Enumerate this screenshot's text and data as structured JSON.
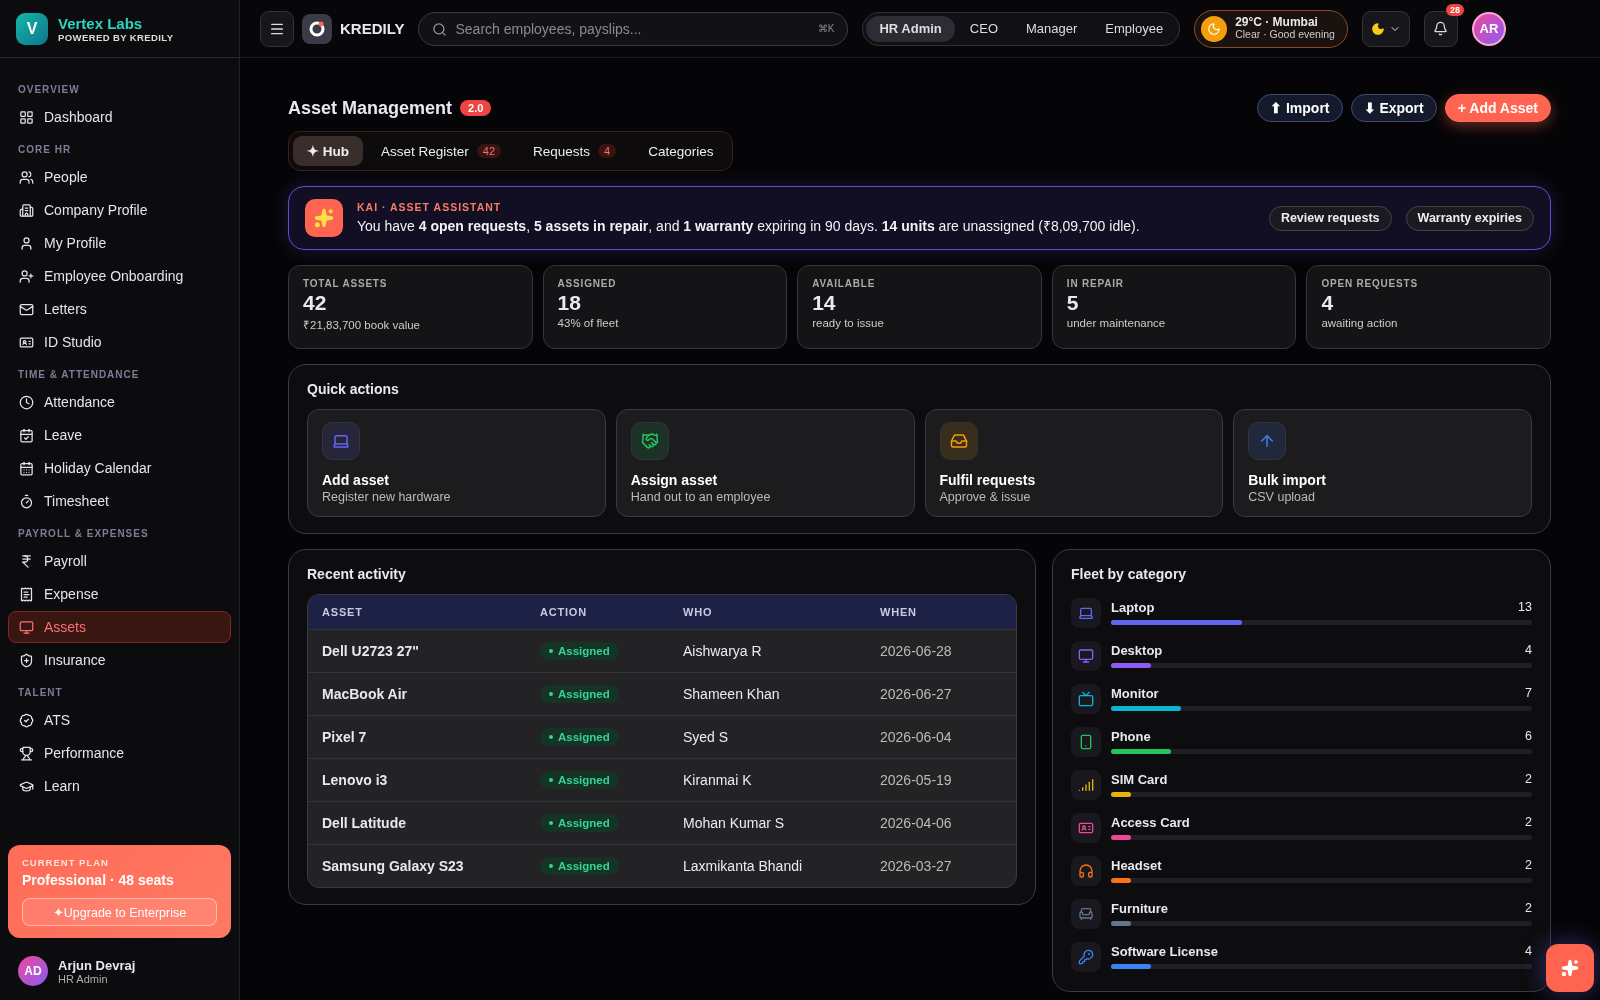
{
  "brand": {
    "initial": "V",
    "name": "Vertex Labs",
    "tagline": "POWERED BY KREDILY"
  },
  "sidebar": {
    "sections": [
      {
        "title": "OVERVIEW",
        "items": [
          {
            "label": "Dashboard",
            "selected": false
          }
        ]
      },
      {
        "title": "CORE HR",
        "items": [
          {
            "label": "People",
            "selected": false
          },
          {
            "label": "Company Profile",
            "selected": false
          },
          {
            "label": "My Profile",
            "selected": false
          },
          {
            "label": "Employee Onboarding",
            "selected": false
          },
          {
            "label": "Letters",
            "selected": false
          },
          {
            "label": "ID Studio",
            "selected": false
          }
        ]
      },
      {
        "title": "TIME & ATTENDANCE",
        "items": [
          {
            "label": "Attendance",
            "selected": false
          },
          {
            "label": "Leave",
            "selected": false
          },
          {
            "label": "Holiday Calendar",
            "selected": false
          },
          {
            "label": "Timesheet",
            "selected": false
          }
        ]
      },
      {
        "title": "PAYROLL & EXPENSES",
        "items": [
          {
            "label": "Payroll",
            "selected": false
          },
          {
            "label": "Expense",
            "selected": false
          },
          {
            "label": "Assets",
            "selected": true
          },
          {
            "label": "Insurance",
            "selected": false
          }
        ]
      },
      {
        "title": "TALENT",
        "items": [
          {
            "label": "ATS",
            "selected": false
          },
          {
            "label": "Performance",
            "selected": false
          },
          {
            "label": "Learn",
            "selected": false
          }
        ]
      }
    ],
    "plan": {
      "caption": "CURRENT PLAN",
      "name": "Professional · 48 seats",
      "upgrade": "✦Upgrade to Enterprise"
    },
    "user": {
      "initials": "AD",
      "name": "Arjun Devraj",
      "role": "HR Admin"
    }
  },
  "topbar": {
    "product": "KREDILY",
    "search": {
      "placeholder": "Search employees, payslips...",
      "shortcut": "⌘K"
    },
    "roles": [
      {
        "label": "HR Admin",
        "selected": true
      },
      {
        "label": "CEO",
        "selected": false
      },
      {
        "label": "Manager",
        "selected": false
      },
      {
        "label": "Employee",
        "selected": false
      }
    ],
    "weather": {
      "temp": "29°C · Mumbai",
      "detail": "Clear · Good evening"
    },
    "notifications": "28",
    "avatar": "AR"
  },
  "page": {
    "title": "Asset Management",
    "version": "2.0",
    "actions": [
      {
        "label": "⬆ Import",
        "kind": "outline"
      },
      {
        "label": "⬇ Export",
        "kind": "outline"
      },
      {
        "label": "+ Add Asset",
        "kind": "primary"
      }
    ],
    "tabs": [
      {
        "label": "✦ Hub",
        "selected": true
      },
      {
        "label": "Asset Register",
        "count": "42",
        "selected": false
      },
      {
        "label": "Requests",
        "count": "4",
        "selected": false
      },
      {
        "label": "Categories",
        "selected": false
      }
    ],
    "assistant": {
      "title": "KAI · ASSET ASSISTANT",
      "message": "You have **4 open requests**, **5 assets in repair**, and **1 warranty** expiring in 90 days. **14 units** are unassigned (₹8,09,700 idle).",
      "buttons": [
        "Review requests",
        "Warranty expiries"
      ]
    },
    "stats": [
      {
        "label": "TOTAL ASSETS",
        "value": "42",
        "note": "₹21,83,700 book value"
      },
      {
        "label": "ASSIGNED",
        "value": "18",
        "note": "43% of fleet"
      },
      {
        "label": "AVAILABLE",
        "value": "14",
        "note": "ready to issue"
      },
      {
        "label": "IN REPAIR",
        "value": "5",
        "note": "under maintenance"
      },
      {
        "label": "OPEN REQUESTS",
        "value": "4",
        "note": "awaiting action"
      }
    ],
    "quick_actions": {
      "title": "Quick actions",
      "items": [
        {
          "title": "Add asset",
          "subtitle": "Register new hardware",
          "color": "#6366f1"
        },
        {
          "title": "Assign asset",
          "subtitle": "Hand out to an employee",
          "color": "#22c55e"
        },
        {
          "title": "Fulfil requests",
          "subtitle": "Approve & issue",
          "color": "#f59e0b"
        },
        {
          "title": "Bulk import",
          "subtitle": "CSV upload",
          "color": "#3b82f6"
        }
      ]
    },
    "recent_activity": {
      "title": "Recent activity",
      "columns": [
        "ASSET",
        "ACTION",
        "WHO",
        "WHEN"
      ],
      "rows": [
        {
          "asset": "Dell U2723 27\"",
          "action": "Assigned",
          "who": "Aishwarya R",
          "when": "2026-06-28"
        },
        {
          "asset": "MacBook Air",
          "action": "Assigned",
          "who": "Shameen Khan",
          "when": "2026-06-27"
        },
        {
          "asset": "Pixel 7",
          "action": "Assigned",
          "who": "Syed S",
          "when": "2026-06-04"
        },
        {
          "asset": "Lenovo i3",
          "action": "Assigned",
          "who": "Kiranmai K",
          "when": "2026-05-19"
        },
        {
          "asset": "Dell Latitude",
          "action": "Assigned",
          "who": "Mohan Kumar S",
          "when": "2026-04-06"
        },
        {
          "asset": "Samsung Galaxy S23",
          "action": "Assigned",
          "who": "Laxmikanta Bhandi",
          "when": "2026-03-27"
        }
      ]
    },
    "fleet": {
      "title": "Fleet by category",
      "items": [
        {
          "name": "Laptop",
          "count": "13",
          "level": 0.31,
          "color": "#6366f1"
        },
        {
          "name": "Desktop",
          "count": "4",
          "level": 0.095,
          "color": "#8b5cf6"
        },
        {
          "name": "Monitor",
          "count": "7",
          "level": 0.167,
          "color": "#06b6d4"
        },
        {
          "name": "Phone",
          "count": "6",
          "level": 0.143,
          "color": "#22c55e"
        },
        {
          "name": "SIM Card",
          "count": "2",
          "level": 0.048,
          "color": "#eab308"
        },
        {
          "name": "Access Card",
          "count": "2",
          "level": 0.048,
          "color": "#ec4899"
        },
        {
          "name": "Headset",
          "count": "2",
          "level": 0.048,
          "color": "#f97316"
        },
        {
          "name": "Furniture",
          "count": "2",
          "level": 0.048,
          "color": "#64748b"
        },
        {
          "name": "Software License",
          "count": "4",
          "level": 0.095,
          "color": "#3b82f6"
        }
      ]
    }
  }
}
